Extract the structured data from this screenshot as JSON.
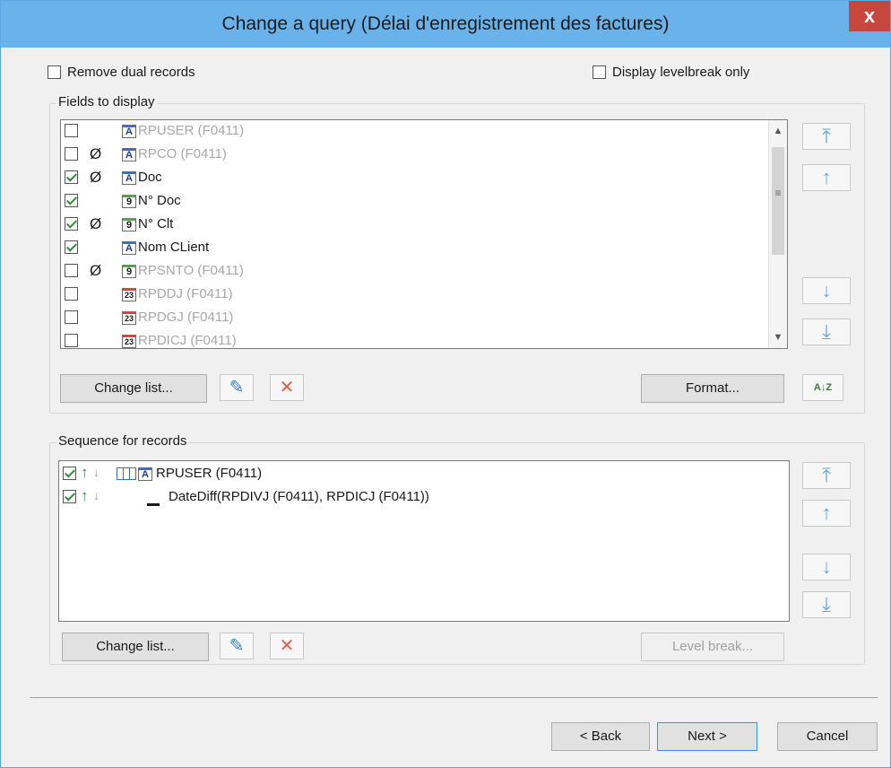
{
  "window": {
    "title": "Change a query (Délai d'enregistrement des factures)",
    "close_glyph": "x"
  },
  "options": {
    "remove_dual": {
      "label": "Remove dual records",
      "checked": false
    },
    "levelbreak_only": {
      "label": "Display levelbreak only",
      "checked": false
    }
  },
  "fields_group": {
    "title": "Fields to display",
    "fields": [
      {
        "name": "RPUSER (F0411)",
        "checked": false,
        "null": false,
        "icon": "text-field-icon",
        "dim": true
      },
      {
        "name": "RPCO (F0411)",
        "checked": false,
        "null": true,
        "icon": "text-field-icon",
        "dim": true
      },
      {
        "name": "Doc",
        "checked": true,
        "null": true,
        "icon": "text-field-icon",
        "dim": false
      },
      {
        "name": "N° Doc",
        "checked": true,
        "null": false,
        "icon": "numeric-field-icon",
        "dim": false
      },
      {
        "name": "N° Clt",
        "checked": true,
        "null": true,
        "icon": "numeric-field-icon",
        "dim": false
      },
      {
        "name": "Nom CLient",
        "checked": true,
        "null": false,
        "icon": "text-field-icon",
        "dim": false
      },
      {
        "name": "RPSNTO (F0411)",
        "checked": false,
        "null": true,
        "icon": "numeric-field-icon",
        "dim": true
      },
      {
        "name": "RPDDJ (F0411)",
        "checked": false,
        "null": false,
        "icon": "date-field-icon",
        "dim": true
      },
      {
        "name": "RPDGJ (F0411)",
        "checked": false,
        "null": false,
        "icon": "date-field-icon",
        "dim": true
      },
      {
        "name": "RPDICJ (F0411)",
        "checked": false,
        "null": false,
        "icon": "date-field-icon",
        "dim": true
      }
    ],
    "change_list_label": "Change list...",
    "format_label": "Format..."
  },
  "sequence_group": {
    "title": "Sequence for records",
    "items": [
      {
        "name": "RPUSER (F0411)",
        "checked": true
      },
      {
        "name": "DateDiff(RPDIVJ (F0411), RPDICJ (F0411))",
        "checked": true
      }
    ],
    "change_list_label": "Change list...",
    "level_break_label": "Level break..."
  },
  "footer": {
    "back_label": "< Back",
    "next_label": "Next >",
    "cancel_label": "Cancel"
  },
  "icon_glyphs": {
    "null": "Ø",
    "text": "A",
    "numeric": "9",
    "date": "23",
    "move_top": "⤒",
    "move_up": "↑",
    "move_down": "↓",
    "move_bottom": "⤓",
    "edit": "✎",
    "delete": "✕",
    "sort": "A↓Z",
    "scroll_up": "▲",
    "scroll_down": "▼",
    "scroll_grip": "≡",
    "asc": "↑",
    "desc": "↓"
  },
  "colors": {
    "title_bar": "#6ab3ea",
    "close_button": "#c7463d",
    "arrow_blue": "#5fa7dc",
    "delete_red": "#e06050",
    "check_green": "#2e8b3a"
  }
}
